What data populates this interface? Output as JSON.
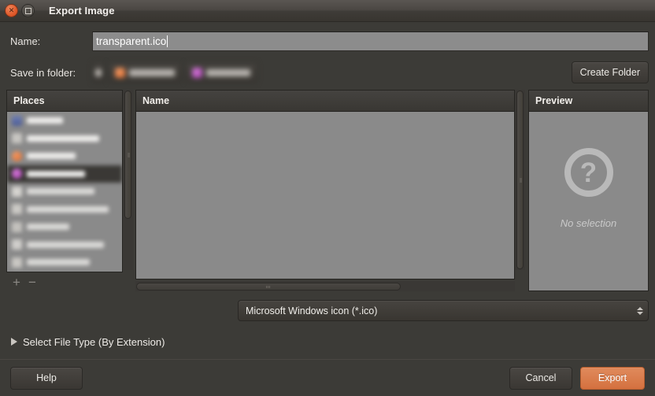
{
  "window": {
    "title": "Export Image",
    "close_icon": "close-icon",
    "maximize_icon": "maximize-icon"
  },
  "name_row": {
    "label": "Name:",
    "value": "transparent.ico",
    "placeholder": ""
  },
  "folder_row": {
    "label": "Save in folder:",
    "create_folder_label": "Create Folder",
    "breadcrumbs": [
      {
        "label": "",
        "icon": "ellipsis-icon",
        "redacted": true
      },
      {
        "label": "",
        "icon": "home-folder-icon",
        "redacted": true
      },
      {
        "label": "",
        "icon": "desktop-folder-icon",
        "redacted": true
      }
    ]
  },
  "places": {
    "header": "Places",
    "items": [
      {
        "label": "",
        "icon": "search-icon",
        "redacted": true,
        "selected": false
      },
      {
        "label": "",
        "icon": "recent-icon",
        "redacted": true,
        "selected": false
      },
      {
        "label": "",
        "icon": "home-icon",
        "redacted": true,
        "selected": false
      },
      {
        "label": "",
        "icon": "desktop-icon",
        "redacted": true,
        "selected": true
      },
      {
        "label": "",
        "icon": "filesystem-icon",
        "redacted": true,
        "selected": false
      },
      {
        "label": "",
        "icon": "volume-icon",
        "redacted": true,
        "selected": false
      },
      {
        "label": "",
        "icon": "device-icon",
        "redacted": true,
        "selected": false
      },
      {
        "label": "",
        "icon": "removable-icon",
        "redacted": true,
        "selected": false
      },
      {
        "label": "",
        "icon": "floppy-icon",
        "redacted": true,
        "selected": false
      },
      {
        "label": "",
        "icon": "folder-icon",
        "redacted": true,
        "selected": false
      }
    ],
    "add_label": "+",
    "remove_label": "−"
  },
  "files": {
    "column_header": "Name",
    "rows": []
  },
  "preview": {
    "header": "Preview",
    "icon": "question-mark-icon",
    "icon_glyph": "?",
    "empty_text": "No selection"
  },
  "filetype": {
    "selected": "Microsoft Windows icon (*.ico)",
    "options": [
      "Microsoft Windows icon (*.ico)"
    ]
  },
  "expander": {
    "label": "Select File Type (By Extension)",
    "expanded": false
  },
  "actions": {
    "help_label": "Help",
    "cancel_label": "Cancel",
    "export_label": "Export"
  },
  "colors": {
    "accent": "#d4713f",
    "window_bg": "#3c3b37",
    "list_bg": "#8a8a8a",
    "text": "#eeebe7"
  }
}
